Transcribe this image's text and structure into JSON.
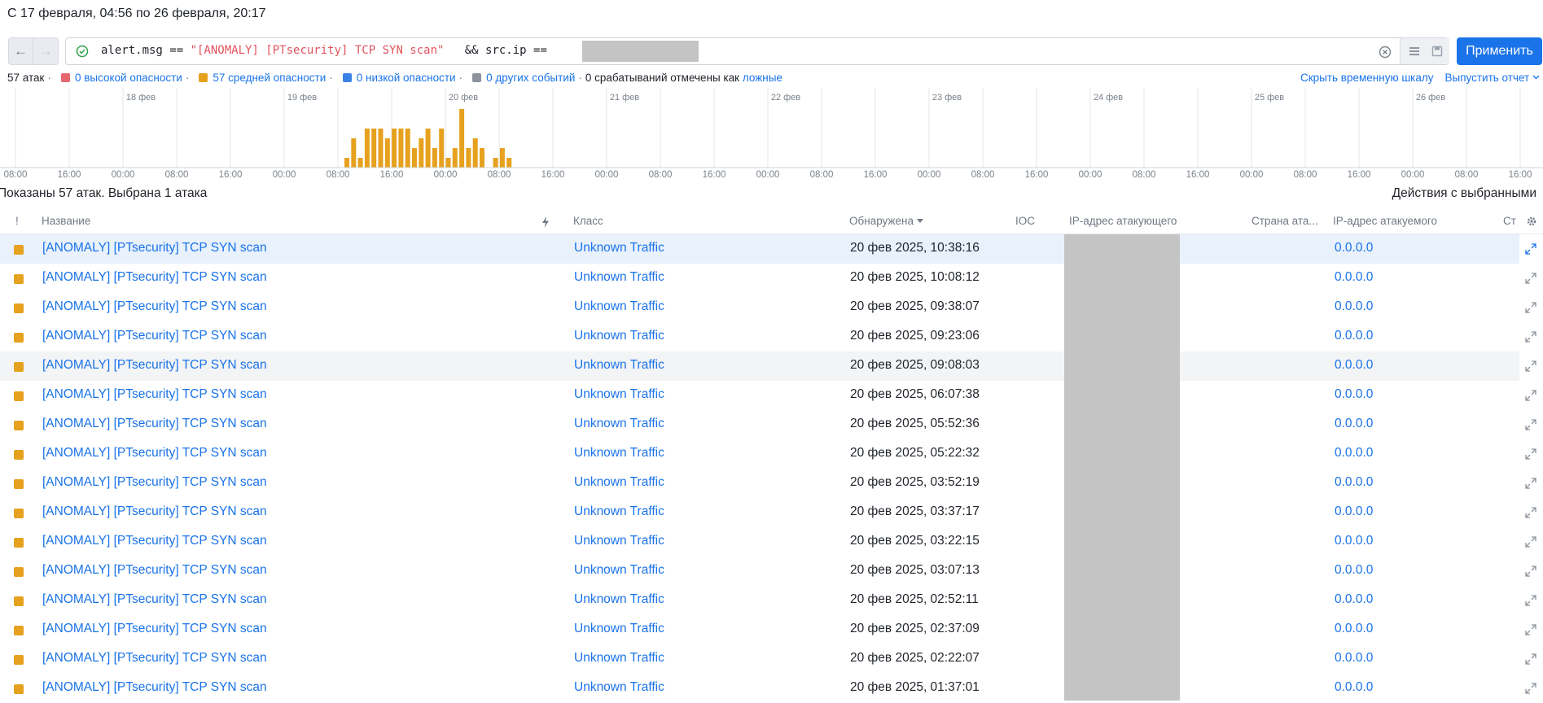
{
  "period_text": "С 17 февраля, 04:56 по 26 февраля, 20:17",
  "nav": {
    "back": "←",
    "forward": "→"
  },
  "query": {
    "part1": "alert.msg == ",
    "part2": "\"[ANOMALY] [PTsecurity] TCP SYN scan\"",
    "part3": "   && src.ip == "
  },
  "apply_label": "Применить",
  "stats": {
    "total": "57 атак",
    "high": "0 высокой опасности",
    "medium": "57 средней опасности",
    "low": "0 низкой опасности",
    "other": "0 других событий",
    "false_text": "0 срабатываний отмечены как",
    "false_link": "ложные"
  },
  "colors": {
    "high": "#e5676f",
    "medium": "#e6a11e",
    "low": "#3b82e6",
    "other": "#8c939c",
    "accent": "#1a73e8"
  },
  "top_links": {
    "hide_timeline": "Скрыть временную шкалу",
    "report": "Выпустить отчет"
  },
  "timeline": {
    "day_labels": [
      "18 фев",
      "19 фев",
      "20 фев",
      "21 фев",
      "22 фев",
      "23 фев",
      "24 фев",
      "25 фев",
      "26 фев"
    ],
    "hour_labels": [
      "08:00",
      "16:00",
      "00:00",
      "08:00",
      "16:00",
      "00:00",
      "08:00",
      "16:00",
      "00:00",
      "08:00",
      "16:00",
      "00:00",
      "08:00",
      "16:00",
      "00:00",
      "08:00",
      "16:00",
      "00:00",
      "08:00",
      "16:00",
      "00:00",
      "08:00",
      "16:00",
      "00:00",
      "08:00",
      "16:00",
      "00:00",
      "08:00",
      "16:00"
    ],
    "bins": [
      1,
      3,
      1,
      4,
      4,
      4,
      3,
      4,
      4,
      4,
      2,
      3,
      4,
      2,
      4,
      1,
      2,
      6,
      2,
      3,
      2,
      0,
      1,
      2,
      1
    ]
  },
  "shown_info": "Показаны 57 атак.  Выбрана 1 атака",
  "actions_label": "Действия с выбранными",
  "columns": {
    "sev": "!",
    "name": "Название",
    "class": "Класс",
    "detected": "Обнаружена",
    "ioc": "IOC",
    "src_ip": "IP-адрес атакующего",
    "src_country": "Страна ата...",
    "dst_ip": "IP-адрес атакуемого",
    "more": "Ст"
  },
  "rows": [
    {
      "name": "[ANOMALY] [PTsecurity] TCP SYN scan",
      "class": "Unknown Traffic",
      "time": "20 фев 2025, 10:38:16",
      "dst": "0.0.0.0"
    },
    {
      "name": "[ANOMALY] [PTsecurity] TCP SYN scan",
      "class": "Unknown Traffic",
      "time": "20 фев 2025, 10:08:12",
      "dst": "0.0.0.0"
    },
    {
      "name": "[ANOMALY] [PTsecurity] TCP SYN scan",
      "class": "Unknown Traffic",
      "time": "20 фев 2025, 09:38:07",
      "dst": "0.0.0.0"
    },
    {
      "name": "[ANOMALY] [PTsecurity] TCP SYN scan",
      "class": "Unknown Traffic",
      "time": "20 фев 2025, 09:23:06",
      "dst": "0.0.0.0"
    },
    {
      "name": "[ANOMALY] [PTsecurity] TCP SYN scan",
      "class": "Unknown Traffic",
      "time": "20 фев 2025, 09:08:03",
      "dst": "0.0.0.0"
    },
    {
      "name": "[ANOMALY] [PTsecurity] TCP SYN scan",
      "class": "Unknown Traffic",
      "time": "20 фев 2025, 06:07:38",
      "dst": "0.0.0.0"
    },
    {
      "name": "[ANOMALY] [PTsecurity] TCP SYN scan",
      "class": "Unknown Traffic",
      "time": "20 фев 2025, 05:52:36",
      "dst": "0.0.0.0"
    },
    {
      "name": "[ANOMALY] [PTsecurity] TCP SYN scan",
      "class": "Unknown Traffic",
      "time": "20 фев 2025, 05:22:32",
      "dst": "0.0.0.0"
    },
    {
      "name": "[ANOMALY] [PTsecurity] TCP SYN scan",
      "class": "Unknown Traffic",
      "time": "20 фев 2025, 03:52:19",
      "dst": "0.0.0.0"
    },
    {
      "name": "[ANOMALY] [PTsecurity] TCP SYN scan",
      "class": "Unknown Traffic",
      "time": "20 фев 2025, 03:37:17",
      "dst": "0.0.0.0"
    },
    {
      "name": "[ANOMALY] [PTsecurity] TCP SYN scan",
      "class": "Unknown Traffic",
      "time": "20 фев 2025, 03:22:15",
      "dst": "0.0.0.0"
    },
    {
      "name": "[ANOMALY] [PTsecurity] TCP SYN scan",
      "class": "Unknown Traffic",
      "time": "20 фев 2025, 03:07:13",
      "dst": "0.0.0.0"
    },
    {
      "name": "[ANOMALY] [PTsecurity] TCP SYN scan",
      "class": "Unknown Traffic",
      "time": "20 фев 2025, 02:52:11",
      "dst": "0.0.0.0"
    },
    {
      "name": "[ANOMALY] [PTsecurity] TCP SYN scan",
      "class": "Unknown Traffic",
      "time": "20 фев 2025, 02:37:09",
      "dst": "0.0.0.0"
    },
    {
      "name": "[ANOMALY] [PTsecurity] TCP SYN scan",
      "class": "Unknown Traffic",
      "time": "20 фев 2025, 02:22:07",
      "dst": "0.0.0.0"
    },
    {
      "name": "[ANOMALY] [PTsecurity] TCP SYN scan",
      "class": "Unknown Traffic",
      "time": "20 фев 2025, 01:37:01",
      "dst": "0.0.0.0"
    }
  ]
}
